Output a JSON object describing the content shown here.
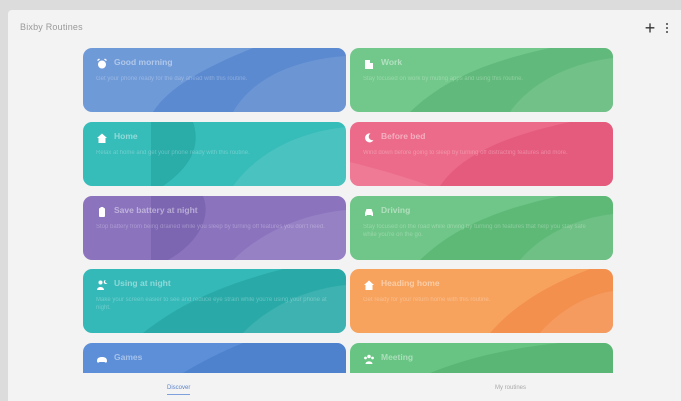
{
  "app": {
    "title": "Bixby Routines"
  },
  "toolbar": {
    "add_label": "+"
  },
  "routines": [
    {
      "id": "good-morning",
      "name": "Good morning",
      "desc": "Get your phone ready for the day ahead with this routine.",
      "icon": "alarm-clock-icon",
      "color": "#6f9ad8",
      "dark": "#5584cd"
    },
    {
      "id": "work",
      "name": "Work",
      "desc": "Stay focused on work by muting apps and using this routine.",
      "icon": "building-icon",
      "color": "#72c88b",
      "dark": "#5cb676"
    },
    {
      "id": "home",
      "name": "Home",
      "desc": "Relax at home and get your phone ready with this routine.",
      "icon": "home-icon",
      "color": "#36bcb9",
      "dark": "#27a7a4"
    },
    {
      "id": "before-bed",
      "name": "Before bed",
      "desc": "Wind down before going to sleep by turning off distracting features and more.",
      "icon": "moon-icon",
      "color": "#ec6b8a",
      "dark": "#e35679"
    },
    {
      "id": "save-battery",
      "name": "Save battery at night",
      "desc": "Stop battery from being drained while you sleep by turning off features you don't need.",
      "icon": "battery-icon",
      "color": "#8b73be",
      "dark": "#7761ad"
    },
    {
      "id": "driving",
      "name": "Driving",
      "desc": "Stay focused on the road while driving by turning on features that help you stay safe while you're on the go.",
      "icon": "car-icon",
      "color": "#6fc688",
      "dark": "#58b472"
    },
    {
      "id": "using-at-night",
      "name": "Using at night",
      "desc": "Make your screen easier to see and reduce eye strain while you're using your phone at night.",
      "icon": "person-night-icon",
      "color": "#34b9b8",
      "dark": "#25a5a3"
    },
    {
      "id": "heading-home",
      "name": "Heading home",
      "desc": "Get ready for your return home with this routine.",
      "icon": "home-icon",
      "color": "#f7a35e",
      "dark": "#f3894a"
    },
    {
      "id": "games",
      "name": "Games",
      "desc": "",
      "icon": "gamepad-icon",
      "color": "#5c8fd8",
      "dark": "#4a7dca"
    },
    {
      "id": "meeting",
      "name": "Meeting",
      "desc": "",
      "icon": "group-icon",
      "color": "#67c482",
      "dark": "#55b26f"
    }
  ],
  "tabs": {
    "discover": "Discover",
    "my_routines": "My routines"
  }
}
